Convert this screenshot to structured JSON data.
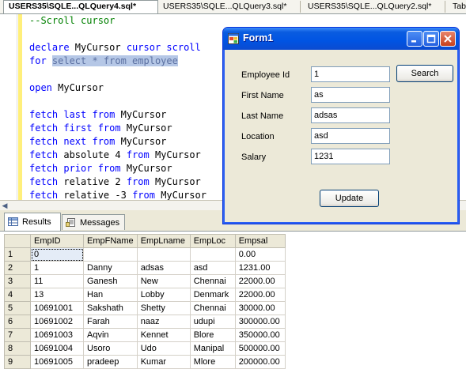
{
  "doc_tabs": [
    {
      "label": "USERS35\\SQLE...QLQuery4.sql*",
      "active": true
    },
    {
      "label": "USERS35\\SQLE...QLQuery3.sql*",
      "active": false
    },
    {
      "label": "USERS35\\SQLE...QLQuery2.sql*",
      "active": false
    },
    {
      "label": "Tab",
      "active": false
    }
  ],
  "editor": {
    "lines": [
      [
        {
          "t": "--Scroll cursor",
          "c": "cm"
        }
      ],
      [],
      [
        {
          "t": "declare ",
          "c": "kw"
        },
        {
          "t": "MyCursor ",
          "c": "plain"
        },
        {
          "t": "cursor scroll",
          "c": "kw"
        }
      ],
      [
        {
          "t": "for ",
          "c": "kw"
        },
        {
          "t": "select * from employee",
          "c": "sel"
        }
      ],
      [],
      [
        {
          "t": "open ",
          "c": "kw"
        },
        {
          "t": "MyCursor",
          "c": "plain"
        }
      ],
      [],
      [
        {
          "t": "fetch last from ",
          "c": "kw"
        },
        {
          "t": "MyCursor",
          "c": "plain"
        }
      ],
      [
        {
          "t": "fetch first from ",
          "c": "kw"
        },
        {
          "t": "MyCursor",
          "c": "plain"
        }
      ],
      [
        {
          "t": "fetch next from ",
          "c": "kw"
        },
        {
          "t": "MyCursor",
          "c": "plain"
        }
      ],
      [
        {
          "t": "fetch ",
          "c": "kw"
        },
        {
          "t": "absolute 4 ",
          "c": "plain"
        },
        {
          "t": "from ",
          "c": "kw"
        },
        {
          "t": "MyCursor",
          "c": "plain"
        }
      ],
      [
        {
          "t": "fetch prior from ",
          "c": "kw"
        },
        {
          "t": "MyCursor",
          "c": "plain"
        }
      ],
      [
        {
          "t": "fetch ",
          "c": "kw"
        },
        {
          "t": "relative 2 ",
          "c": "plain"
        },
        {
          "t": "from ",
          "c": "kw"
        },
        {
          "t": "MyCursor",
          "c": "plain"
        }
      ],
      [
        {
          "t": "fetch ",
          "c": "kw"
        },
        {
          "t": "relative -3 ",
          "c": "plain"
        },
        {
          "t": "from ",
          "c": "kw"
        },
        {
          "t": "MyCursor",
          "c": "plain"
        }
      ]
    ]
  },
  "result_tabs": {
    "results_label": "Results",
    "messages_label": "Messages"
  },
  "grid": {
    "columns": [
      "EmpID",
      "EmpFName",
      "EmpLname",
      "EmpLoc",
      "Empsal"
    ],
    "rows": [
      [
        "1",
        "0",
        "",
        "",
        "",
        "0.00"
      ],
      [
        "2",
        "1",
        "Danny",
        "adsas",
        "asd",
        "1231.00"
      ],
      [
        "3",
        "11",
        "Ganesh",
        "New",
        "Chennai",
        "22000.00"
      ],
      [
        "4",
        "13",
        "Han",
        "Lobby",
        "Denmark",
        "22000.00"
      ],
      [
        "5",
        "10691001",
        "Sakshath",
        "Shetty",
        "Chennai",
        "30000.00"
      ],
      [
        "6",
        "10691002",
        "Farah",
        "naaz",
        "udupi",
        "300000.00"
      ],
      [
        "7",
        "10691003",
        "Aqvin",
        "Kennet",
        "Blore",
        "350000.00"
      ],
      [
        "8",
        "10691004",
        "Usoro",
        "Udo",
        "Manipal",
        "500000.00"
      ],
      [
        "9",
        "10691005",
        "pradeep",
        "Kumar",
        "Mlore",
        "200000.00"
      ]
    ]
  },
  "form": {
    "title": "Form1",
    "fields": {
      "emp_id": {
        "label": "Employee Id",
        "value": "1"
      },
      "first_name": {
        "label": "First Name",
        "value": "as"
      },
      "last_name": {
        "label": "Last Name",
        "value": "adsas"
      },
      "location": {
        "label": "Location",
        "value": "asd"
      },
      "salary": {
        "label": "Salary",
        "value": "1231"
      }
    },
    "search_label": "Search",
    "update_label": "Update"
  },
  "colors": {
    "keyword": "#0000ff",
    "comment": "#008000",
    "selection": "#b5c7e6",
    "titlebar": "#0054e3",
    "close_button": "#c8401c"
  }
}
